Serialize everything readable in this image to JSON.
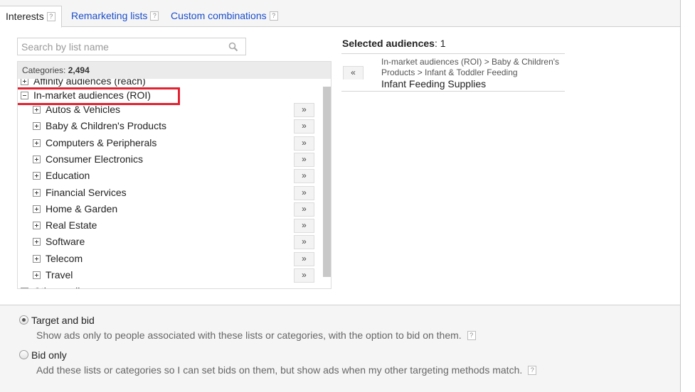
{
  "tabs": [
    {
      "label": "Interests",
      "active": true
    },
    {
      "label": "Remarketing lists",
      "active": false
    },
    {
      "label": "Custom combinations",
      "active": false
    }
  ],
  "help_glyph": "?",
  "search": {
    "placeholder": "Search by list name",
    "value": "",
    "icon": "search-icon"
  },
  "categories": {
    "label": "Categories:",
    "count": "2,494"
  },
  "tree": {
    "partial_top": "Affinity audiences (reach)",
    "expanded_parent": "In-market audiences (ROI)",
    "children": [
      "Autos & Vehicles",
      "Baby & Children's Products",
      "Computers & Peripherals",
      "Consumer Electronics",
      "Education",
      "Financial Services",
      "Home & Garden",
      "Real Estate",
      "Software",
      "Telecom",
      "Travel"
    ],
    "partial_bottom": "Other audiences",
    "add_glyph": "»"
  },
  "selected": {
    "label": "Selected audiences",
    "count": ": 1",
    "remove_glyph": "«",
    "items": [
      {
        "path": "In-market audiences (ROI) > Baby & Children's Products > Infant & Toddler Feeding",
        "name": "Infant Feeding Supplies"
      }
    ]
  },
  "targeting": {
    "options": [
      {
        "label": "Target and bid",
        "checked": true,
        "description": "Show ads only to people associated with these lists or categories, with the option to bid on them."
      },
      {
        "label": "Bid only",
        "checked": false,
        "description": "Add these lists or categories so I can set bids on them, but show ads when my other targeting methods match."
      }
    ]
  },
  "colors": {
    "link": "#1a4dcc",
    "highlight_box": "#e32231"
  }
}
